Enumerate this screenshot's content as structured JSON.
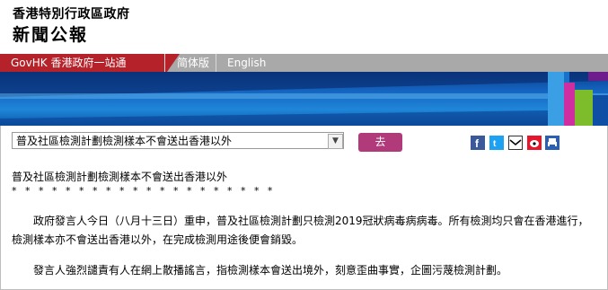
{
  "header": {
    "gov_name": "香港特別行政區政府",
    "press_title": "新聞公報"
  },
  "nav": {
    "govhk": "GovHK 香港政府一站通",
    "simplified": "简体版",
    "english": "English"
  },
  "form": {
    "selected_article": "普及社區檢測計劃檢測樣本不會送出香港以外",
    "go_label": "去"
  },
  "share_icons": [
    "facebook-icon",
    "twitter-icon",
    "email-icon",
    "weibo-icon",
    "print-icon"
  ],
  "article": {
    "title": "普及社區檢測計劃檢測樣本不會送出香港以外",
    "stars": "* * * * * * * * * * * * * * * * * * * *",
    "paragraphs": [
      "政府發言人今日（八月十三日）重申，普及社區檢測計劃只檢測2019冠狀病毒病病毒。所有檢測均只會在香港進行，檢測樣本亦不會送出香港以外，在完成檢測用途後便會銷毀。",
      "發言人強烈譴責有人在網上散播謠言，指檢測樣本會送出境外，刻意歪曲事實，企圖污蔑檢測計劃。"
    ]
  },
  "colors": {
    "govhk_tab": "#b5222a",
    "nav_bar": "#a9a9a9",
    "go_button": "#b03a7a"
  }
}
